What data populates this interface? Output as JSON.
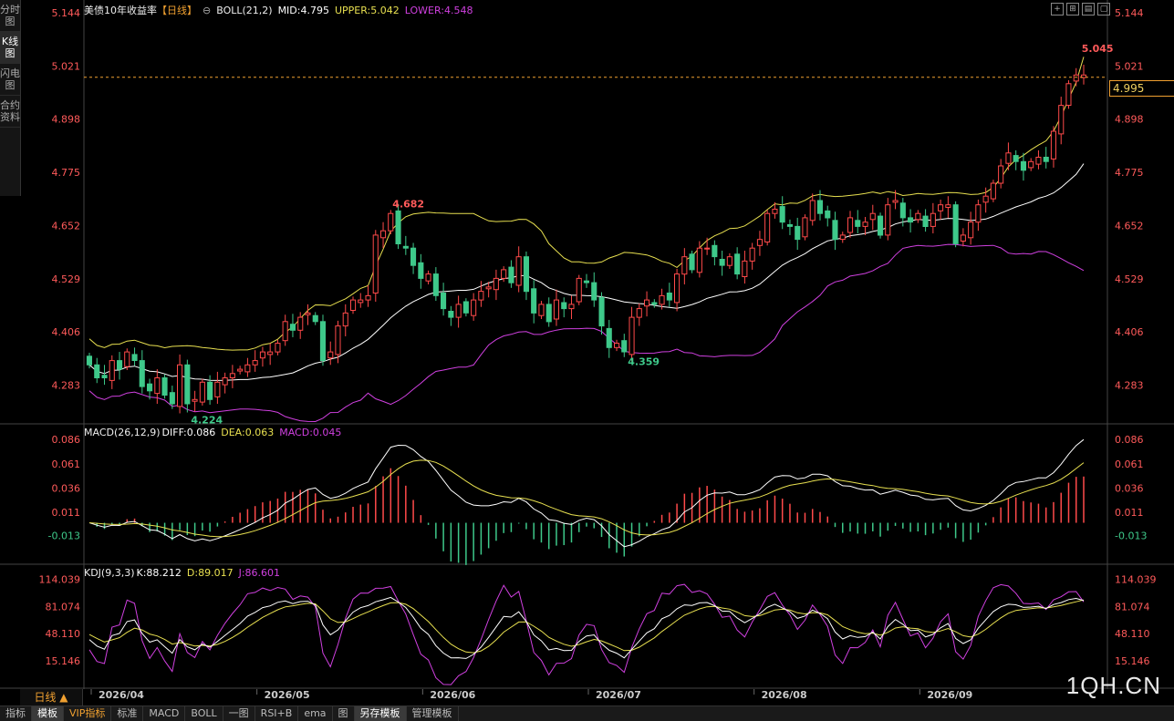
{
  "left_tabs": [
    "分时图",
    "K线图",
    "闪电图",
    "合约资料"
  ],
  "header": {
    "title": "美债10年收益率",
    "period": "【日线】",
    "boll_label": "BOLL(21,2)",
    "mid": "MID:4.795",
    "upper": "UPPER:5.042",
    "lower": "LOWER:4.548"
  },
  "macd_header": {
    "label": "MACD(26,12,9)",
    "diff": "DIFF:0.086",
    "dea": "DEA:0.063",
    "macd": "MACD:0.045"
  },
  "kdj_header": {
    "label": "KDJ(9,3,3)",
    "k": "K:88.212",
    "d": "D:89.017",
    "j": "J:86.601"
  },
  "last_price": "4.995",
  "period_button": "日线 ▲",
  "bottom_tabs": [
    "指标",
    "模板",
    "VIP指标",
    "标准",
    "MACD",
    "BOLL",
    "一图",
    "RSI+B",
    "ema",
    "图",
    "另存模板",
    "管理模板"
  ],
  "watermark": "1QH.CN",
  "colors": {
    "up": "#ff4a4a",
    "down": "#3ec98a",
    "mid": "#ffffff",
    "upper": "#e8e050",
    "lower": "#d040e0",
    "dea": "#e8e050",
    "kdj_j": "#d040e0"
  },
  "chart_data": {
    "type": "candlestick",
    "price_axis": {
      "ticks": [
        "5.144",
        "5.021",
        "4.898",
        "4.775",
        "4.652",
        "4.529",
        "4.406",
        "4.283"
      ],
      "range": [
        4.2,
        5.144
      ]
    },
    "date_labels": [
      "2026/04",
      "2026/05",
      "2026/06",
      "2026/07",
      "2026/08",
      "2026/09"
    ],
    "annotations": {
      "high1": "4.682",
      "low1": "4.224",
      "low2": "4.359",
      "high2": "5.045"
    },
    "macd_axis": {
      "ticks": [
        "0.086",
        "0.061",
        "0.036",
        "0.011",
        "-0.013"
      ],
      "range": [
        -0.04,
        0.09
      ]
    },
    "kdj_axis": {
      "ticks": [
        "114.039",
        "81.074",
        "48.110",
        "15.146"
      ],
      "range": [
        -15,
        118
      ]
    },
    "closes": [
      4.33,
      4.3,
      4.3,
      4.34,
      4.32,
      4.36,
      4.34,
      4.28,
      4.27,
      4.3,
      4.26,
      4.24,
      4.33,
      4.24,
      4.25,
      4.29,
      4.25,
      4.29,
      4.3,
      4.31,
      4.32,
      4.33,
      4.34,
      4.36,
      4.36,
      4.38,
      4.43,
      4.41,
      4.44,
      4.45,
      4.43,
      4.34,
      4.36,
      4.42,
      4.45,
      4.48,
      4.48,
      4.49,
      4.63,
      4.64,
      4.68,
      4.61,
      4.6,
      4.56,
      4.53,
      4.54,
      4.49,
      4.46,
      4.44,
      4.47,
      4.45,
      4.48,
      4.5,
      4.51,
      4.53,
      4.55,
      4.52,
      4.58,
      4.5,
      4.45,
      4.47,
      4.43,
      4.48,
      4.46,
      4.47,
      4.53,
      4.52,
      4.48,
      4.42,
      4.37,
      4.38,
      4.36,
      4.44,
      4.46,
      4.48,
      4.47,
      4.49,
      4.48,
      4.54,
      4.58,
      4.55,
      4.6,
      4.6,
      4.58,
      4.56,
      4.58,
      4.54,
      4.57,
      4.6,
      4.62,
      4.68,
      4.69,
      4.66,
      4.65,
      4.62,
      4.67,
      4.71,
      4.68,
      4.67,
      4.62,
      4.63,
      4.67,
      4.65,
      4.66,
      4.68,
      4.63,
      4.7,
      4.71,
      4.67,
      4.66,
      4.68,
      4.65,
      4.68,
      4.7,
      4.7,
      4.61,
      4.63,
      4.66,
      4.7,
      4.72,
      4.75,
      4.79,
      4.82,
      4.8,
      4.78,
      4.8,
      4.81,
      4.8,
      4.87,
      4.93,
      4.98,
      5.0,
      5.0
    ],
    "series": [
      {
        "name": "MID",
        "values": []
      },
      {
        "name": "UPPER",
        "values": []
      },
      {
        "name": "LOWER",
        "values": []
      },
      {
        "name": "DIFF",
        "values": []
      },
      {
        "name": "DEA",
        "values": []
      },
      {
        "name": "MACD",
        "values": []
      },
      {
        "name": "K",
        "values": []
      },
      {
        "name": "D",
        "values": []
      },
      {
        "name": "J",
        "values": []
      }
    ],
    "final_values": {
      "MID": 4.795,
      "UPPER": 5.042,
      "LOWER": 4.548,
      "DIFF": 0.086,
      "DEA": 0.063,
      "MACD": 0.045,
      "K": 88.212,
      "D": 89.017,
      "J": 86.601
    }
  }
}
